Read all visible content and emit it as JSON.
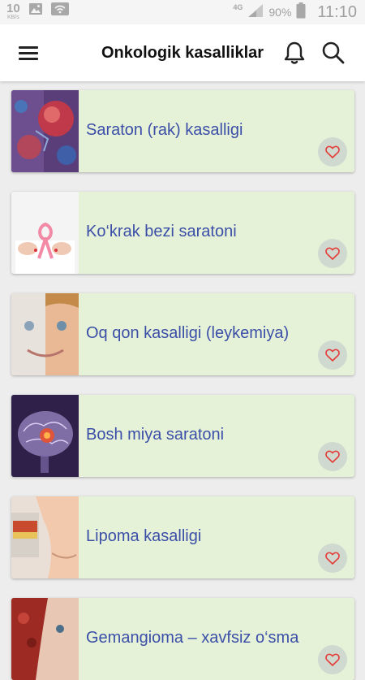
{
  "status_bar": {
    "speed_value": "10",
    "speed_unit": "KB/s",
    "network": "4G",
    "battery_percent": "90%",
    "time": "11:10"
  },
  "app_bar": {
    "title": "Onkologik kasalliklar",
    "icons": [
      "menu-icon",
      "bell-icon",
      "search-icon"
    ]
  },
  "colors": {
    "card_background": "#e6f2d8",
    "title_text": "#3b4fa8",
    "heart": "#e53935",
    "fav_circle": "#cfd9cf"
  },
  "list": {
    "items": [
      {
        "title": "Saraton (rak) kasalligi",
        "favorited": false
      },
      {
        "title": "Ko‘krak bezi saratoni",
        "favorited": false
      },
      {
        "title": "Oq qon kasalligi (leykemiya)",
        "favorited": false
      },
      {
        "title": "Bosh miya saratoni",
        "favorited": false
      },
      {
        "title": "Lipoma kasalligi",
        "favorited": false
      },
      {
        "title": "Gemangioma – xavfsiz o‘sma",
        "favorited": false
      }
    ]
  }
}
